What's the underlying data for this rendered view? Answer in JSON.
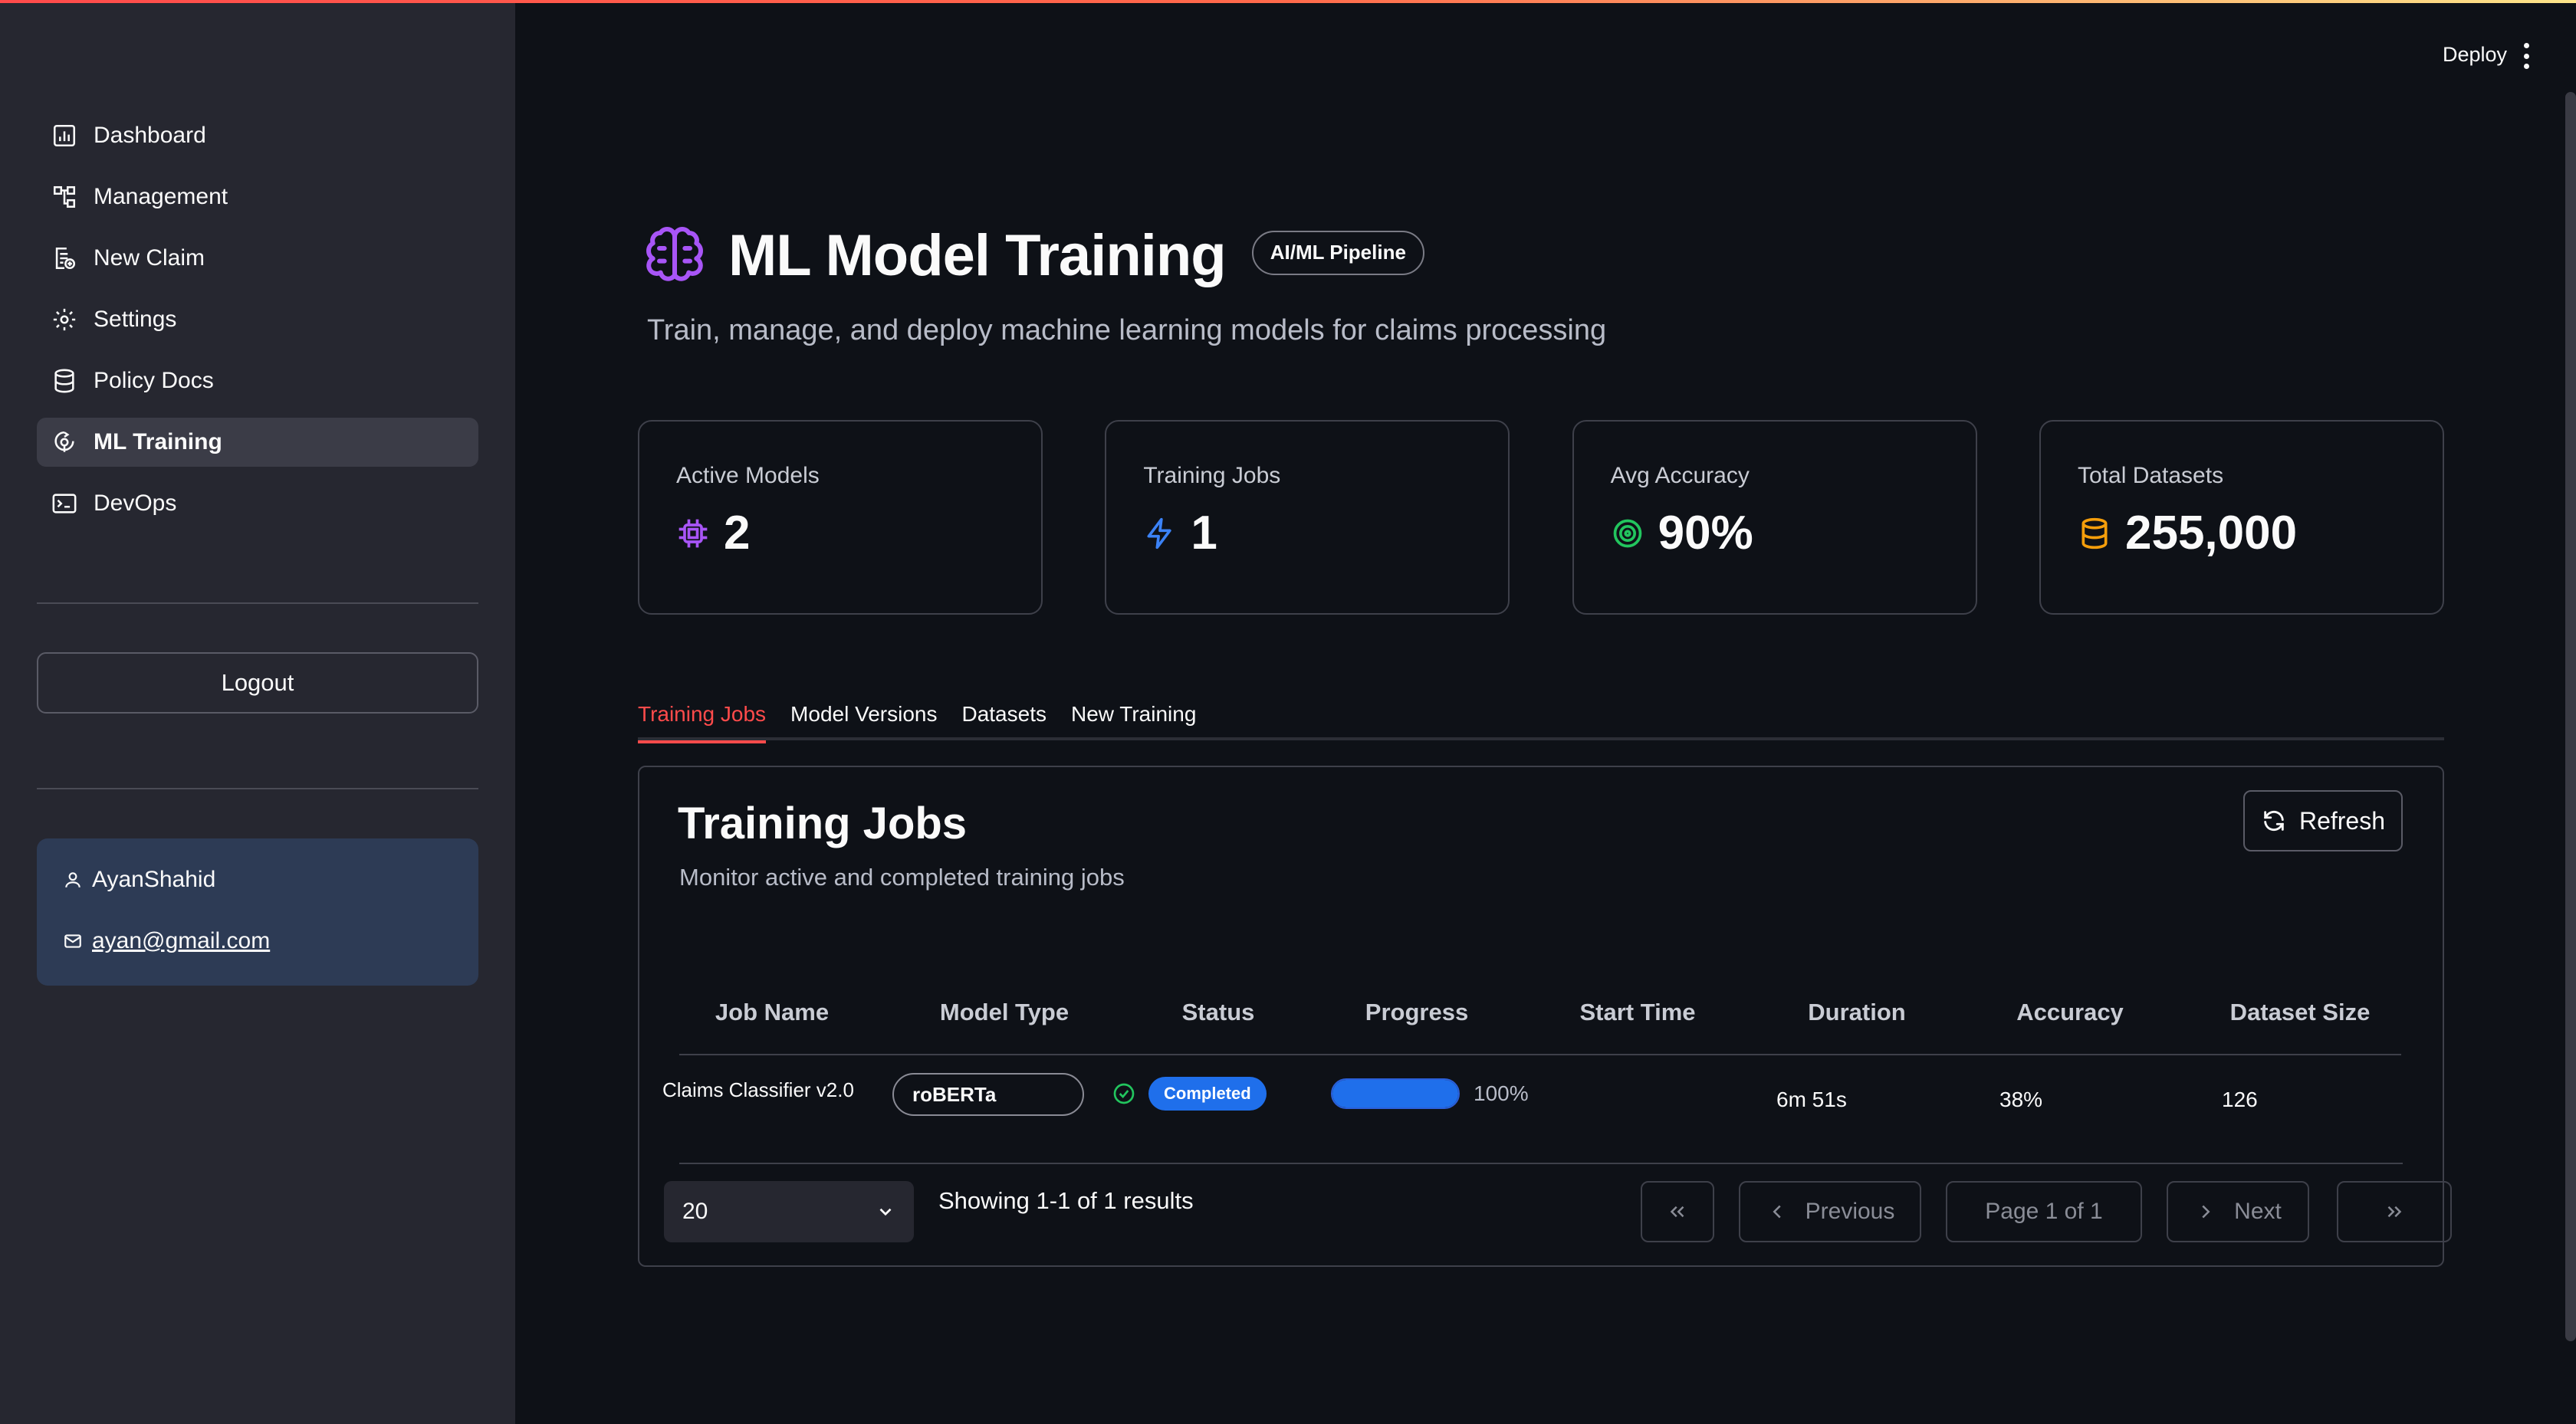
{
  "sidebar": {
    "nav": [
      {
        "label": "Dashboard",
        "icon": "dashboard-icon"
      },
      {
        "label": "Management",
        "icon": "hierarchy-icon"
      },
      {
        "label": "New Claim",
        "icon": "new-claim-icon"
      },
      {
        "label": "Settings",
        "icon": "gear-icon"
      },
      {
        "label": "Policy Docs",
        "icon": "database-icon"
      },
      {
        "label": "ML Training",
        "icon": "ml-training-icon",
        "active": true
      },
      {
        "label": "DevOps",
        "icon": "terminal-icon"
      }
    ],
    "logout_label": "Logout",
    "user": {
      "name": "AyanShahid",
      "email": "ayan@gmail.com"
    }
  },
  "header": {
    "deploy_label": "Deploy"
  },
  "page": {
    "title": "ML Model Training",
    "badge": "AI/ML Pipeline",
    "subtitle": "Train, manage, and deploy machine learning models for claims processing"
  },
  "stats": [
    {
      "label": "Active Models",
      "value": "2",
      "icon": "chip-icon",
      "color": "#a855f7"
    },
    {
      "label": "Training Jobs",
      "value": "1",
      "icon": "lightning-icon",
      "color": "#3b82f6"
    },
    {
      "label": "Avg Accuracy",
      "value": "90%",
      "icon": "target-icon",
      "color": "#22c55e"
    },
    {
      "label": "Total Datasets",
      "value": "255,000",
      "icon": "database-icon",
      "color": "#f59e0b"
    }
  ],
  "tabs": [
    {
      "label": "Training Jobs",
      "active": true
    },
    {
      "label": "Model Versions"
    },
    {
      "label": "Datasets"
    },
    {
      "label": "New Training"
    }
  ],
  "panel": {
    "title": "Training Jobs",
    "subtitle": "Monitor active and completed training jobs",
    "refresh_label": "Refresh"
  },
  "table": {
    "columns": [
      "Job Name",
      "Model Type",
      "Status",
      "Progress",
      "Start Time",
      "Duration",
      "Accuracy",
      "Dataset Size"
    ],
    "rows": [
      {
        "job_name": "Claims Classifier v2.0",
        "model_type": "roBERTa",
        "status": "Completed",
        "progress": 1.0,
        "progress_label": "100%",
        "start_time": "",
        "duration": "6m 51s",
        "accuracy": "38%",
        "dataset_size": "126"
      }
    ]
  },
  "pagination": {
    "page_size": "20",
    "showing": "Showing 1-1 of 1 results",
    "previous_label": "Previous",
    "page_label": "Page 1 of 1",
    "next_label": "Next"
  },
  "colors": {
    "accent": "#ff4b4b",
    "status_badge": "#1f6feb",
    "brain": "#a855f7",
    "user_box": "#2d3b55"
  }
}
